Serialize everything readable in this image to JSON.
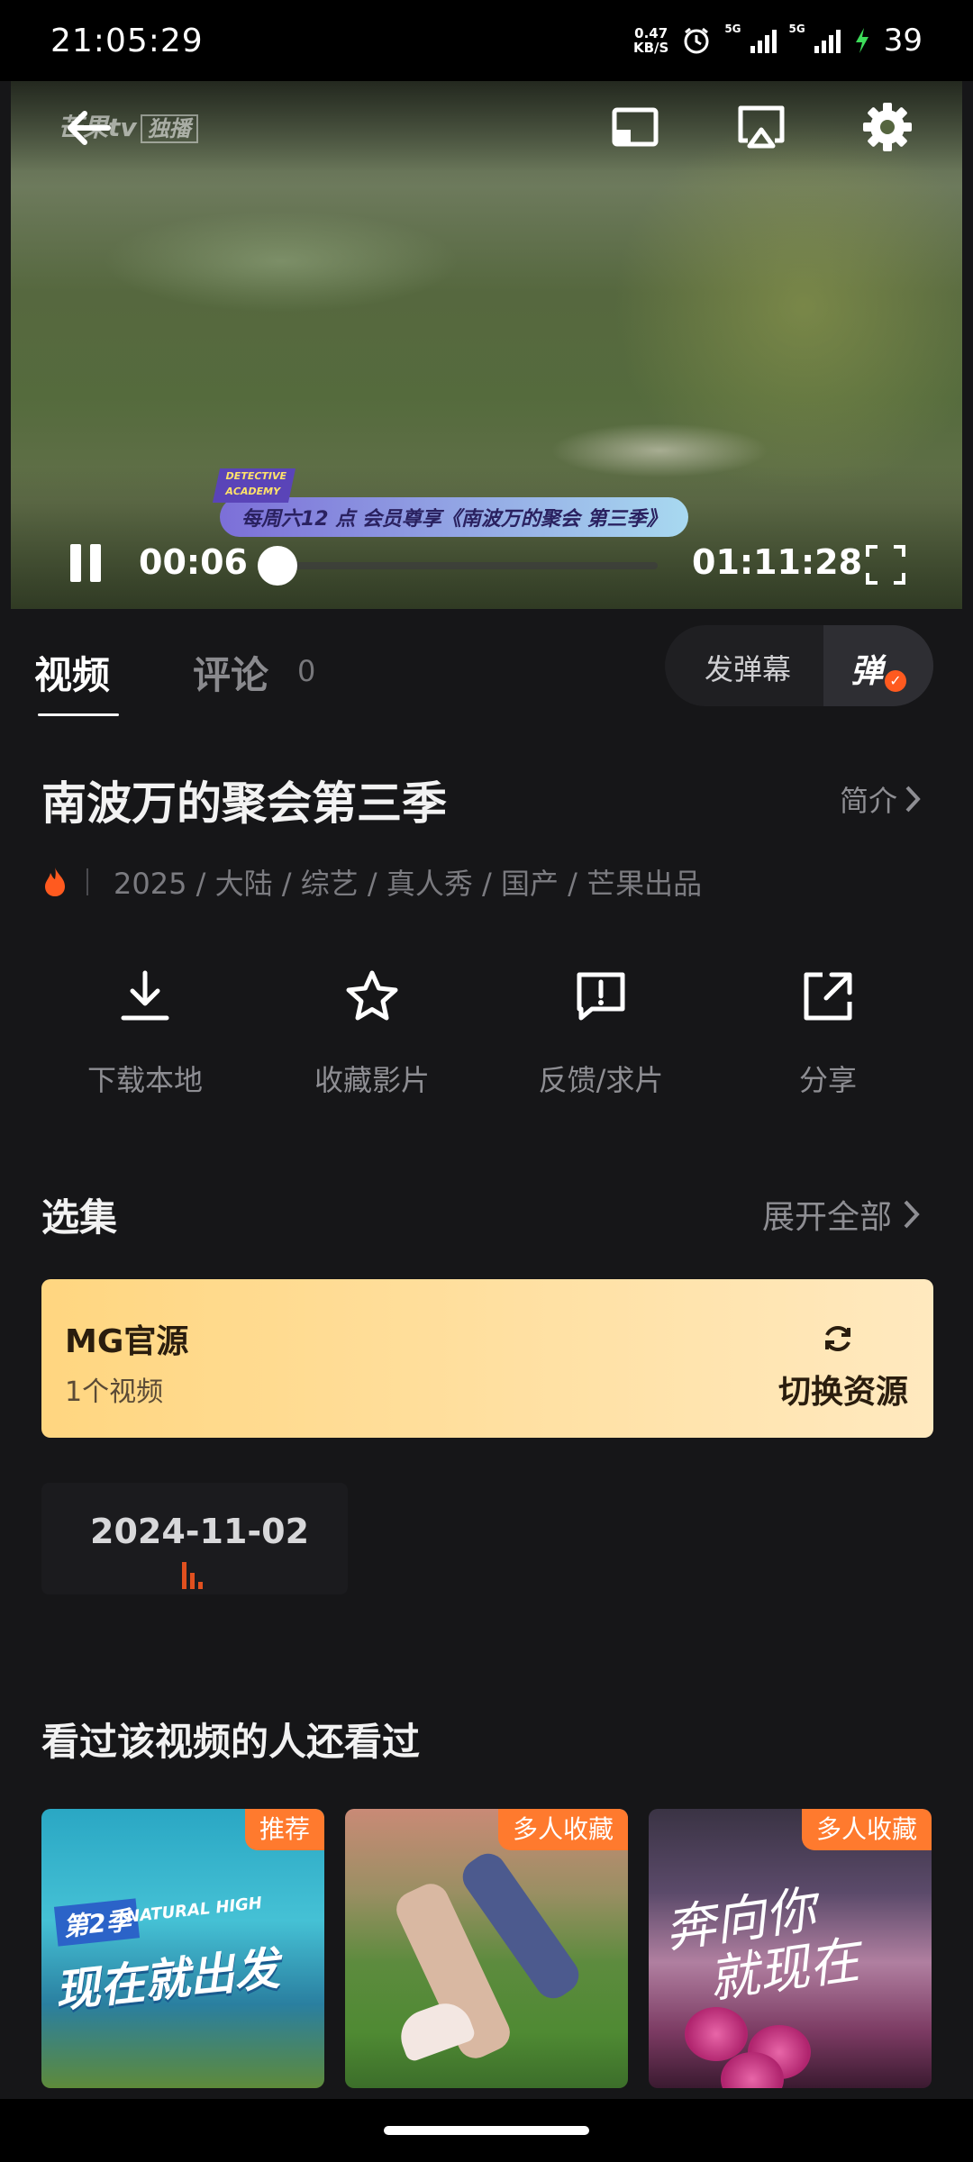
{
  "status_bar": {
    "time": "21:05:29",
    "net_speed_value": "0.47",
    "net_speed_unit": "KB/S",
    "sim1_tag": "5G",
    "sim2_tag": "5G",
    "battery": "39"
  },
  "player": {
    "watermark_brand": "芒果tv",
    "watermark_tag": "独播",
    "banner_tag": "DETECTIVE ACADEMY",
    "banner_text": "每周六12 点 会员尊享《南波万的聚会 第三季》",
    "current_time": "00:06",
    "duration": "01:11:28",
    "progress": 0.0014
  },
  "tabs": {
    "video_label": "视频",
    "comment_label": "评论",
    "comment_count": "0"
  },
  "danmu": {
    "send_label": "发弹幕",
    "toggle_label": "弹",
    "toggle_on": true
  },
  "show": {
    "title": "南波万的聚会第三季",
    "intro_label": "简介",
    "meta": "2025 / 大陆 / 综艺 / 真人秀 / 国产 / 芒果出品"
  },
  "actions": [
    {
      "label": "下载本地",
      "icon": "download-icon"
    },
    {
      "label": "收藏影片",
      "icon": "star-icon"
    },
    {
      "label": "反馈/求片",
      "icon": "feedback-icon"
    },
    {
      "label": "分享",
      "icon": "share-icon"
    }
  ],
  "episodes": {
    "section_title": "选集",
    "expand_label": "展开全部",
    "source_name": "MG官源",
    "source_count": "1个视频",
    "switch_label": "切换资源",
    "items": [
      {
        "label": "2024-11-02",
        "playing": true
      }
    ]
  },
  "recommendations": {
    "section_title": "看过该视频的人还看过",
    "items": [
      {
        "badge": "推荐",
        "art_season": "第2季",
        "art_title": "现在就出发",
        "art_en": "NATURAL HIGH"
      },
      {
        "badge": "多人收藏"
      },
      {
        "badge": "多人收藏",
        "art_title_line1": "奔向你",
        "art_title_line2": "就现在"
      }
    ]
  },
  "colors": {
    "background": "#161618",
    "accent": "#ff5a1f",
    "source_card": "#ffd680",
    "badge": "#ff7a2e"
  }
}
